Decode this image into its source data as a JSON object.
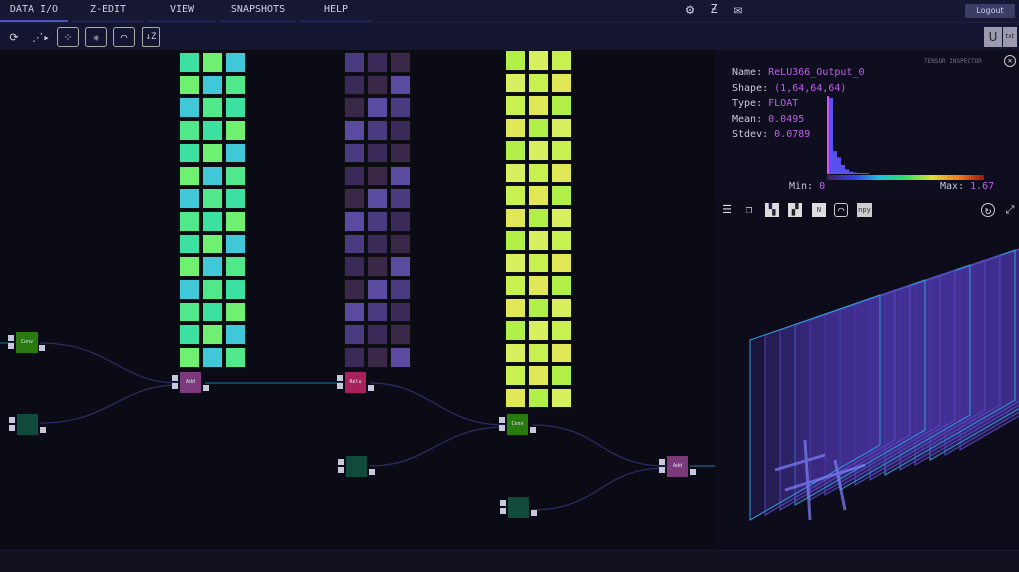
{
  "menu": [
    {
      "label": "DATA I/O",
      "active": true
    },
    {
      "label": "Z-EDIT"
    },
    {
      "label": "VIEW"
    },
    {
      "label": "SNAPSHOTS"
    },
    {
      "label": "HELP"
    }
  ],
  "toolbar": {
    "icons": [
      "z-refresh-icon",
      "graph-run-icon",
      "import-points-icon",
      "import-graph-icon",
      "import-image-icon",
      "z-download-icon"
    ],
    "u_label": "U",
    "txt_label": "txt"
  },
  "header": {
    "icons": [
      "gear-icon",
      "graph-z-icon",
      "mail-icon"
    ],
    "logout_label": "Logout"
  },
  "nodes": [
    {
      "label": "Conv",
      "color": "#2a7a12"
    },
    {
      "label": "Add",
      "color": "#7a3a7c"
    },
    {
      "label": "Relu",
      "color": "#a8205c"
    },
    {
      "label": "Conv",
      "color": "#2a7a12"
    },
    {
      "label": "Add",
      "color": "#7a3a7c"
    },
    {
      "label": "",
      "color": "#0f4a3a"
    },
    {
      "label": "",
      "color": "#0f4a3a"
    },
    {
      "label": "",
      "color": "#0f4a3a"
    }
  ],
  "tile_grids": [
    {
      "rows": 14,
      "cols": 3,
      "palette": [
        "#3ce0a0",
        "#50e88a",
        "#40c8d8",
        "#70f070"
      ]
    },
    {
      "rows": 14,
      "cols": 3,
      "palette": [
        "#3a2a5a",
        "#4a3a80",
        "#5a4aa0",
        "#3a2848"
      ]
    },
    {
      "rows": 16,
      "cols": 3,
      "palette": [
        "#c8f050",
        "#d8f060",
        "#b0f048",
        "#e0e858"
      ]
    }
  ],
  "inspector": {
    "title": "TENSOR INSPECTOR",
    "name_label": "Name:",
    "name": "ReLU366_Output_0",
    "shape_label": "Shape:",
    "shape": "(1,64,64,64)",
    "type_label": "Type:",
    "type": "FLOAT",
    "mean_label": "Mean:",
    "mean": "0.0495",
    "stdev_label": "Stdev:",
    "stdev": "0.0789",
    "min_label": "Min:",
    "min": "0",
    "max_label": "Max:",
    "max": "1.67",
    "histogram": [
      1.0,
      0.3,
      0.22,
      0.12,
      0.06,
      0.03,
      0.02,
      0.01,
      0.005,
      0.003
    ],
    "npy_label": "npy",
    "n_label": "N"
  }
}
